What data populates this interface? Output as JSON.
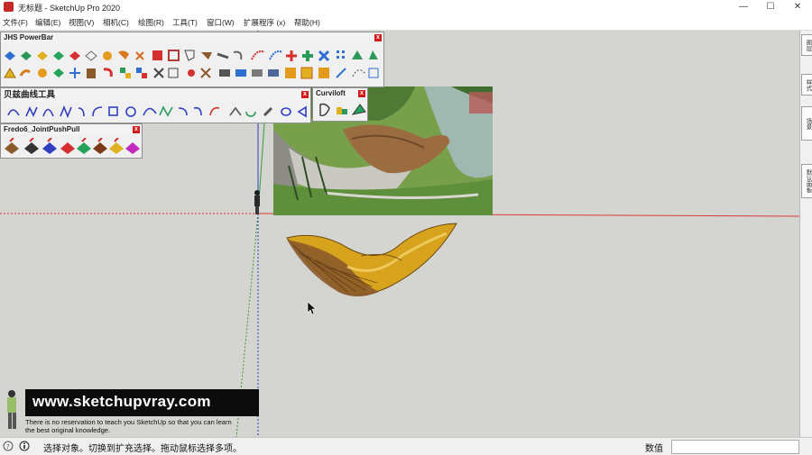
{
  "window": {
    "title": "无标题 - SketchUp Pro 2020",
    "minimize": "—",
    "maximize": "☐",
    "close": "✕"
  },
  "menu": [
    "文件(F)",
    "编辑(E)",
    "视图(V)",
    "相机(C)",
    "绘图(R)",
    "工具(T)",
    "窗口(W)",
    "扩展程序 (x)",
    "帮助(H)"
  ],
  "toolbars": {
    "powerbar": {
      "title": "JHS PowerBar",
      "close": "x"
    },
    "bezier": {
      "title": "贝兹曲线工具",
      "close": "x"
    },
    "curviloft": {
      "title": "Curviloft",
      "close": "x"
    },
    "fredo": {
      "title": "Fredo6_JointPushPull",
      "close": "x"
    }
  },
  "right_tabs": [
    "图层",
    "样式",
    "场景",
    "默认面板"
  ],
  "watermark": {
    "url": "www.sketchupvray.com",
    "caption_line1": "There is no reservation to teach you SketchUp so that you can learn",
    "caption_line2": "the best original knowledge."
  },
  "status": {
    "message": "选择对象。切换到扩充选择。拖动鼠标选择多项。",
    "measure_label": "数值",
    "measure_value": ""
  },
  "colors": {
    "red_axis": "#d9383a",
    "green_axis": "#3a9a3a",
    "blue_axis": "#2f3fbf",
    "shape_fill": "#d7a21c",
    "close_btn": "#d11a1a"
  }
}
